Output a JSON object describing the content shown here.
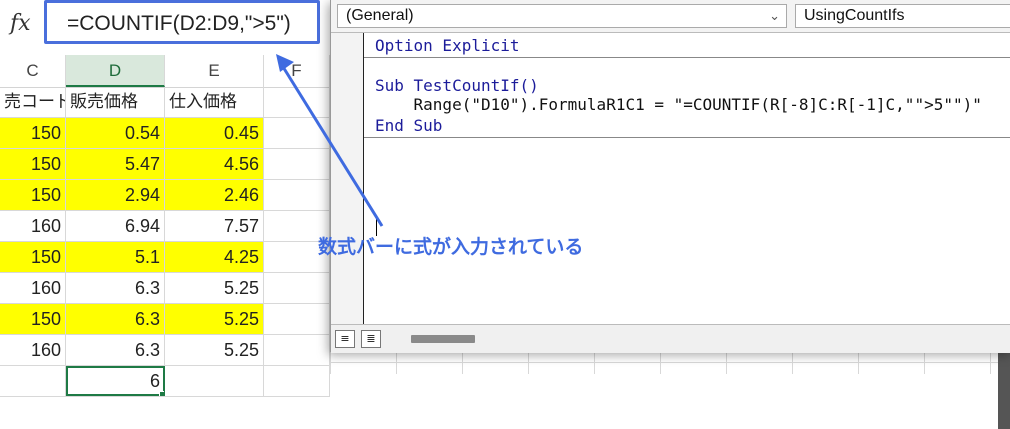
{
  "formula_bar": {
    "fx_label": "fx",
    "formula": "=COUNTIF(D2:D9,\">5\")"
  },
  "columns": [
    "C",
    "D",
    "E",
    "F"
  ],
  "selected_column": "D",
  "headers": {
    "c": "売コード",
    "d": "販売価格",
    "e": "仕入価格"
  },
  "rows": [
    {
      "c": "150",
      "d": "0.54",
      "e": "0.45",
      "highlight": true
    },
    {
      "c": "150",
      "d": "5.47",
      "e": "4.56",
      "highlight": true
    },
    {
      "c": "150",
      "d": "2.94",
      "e": "2.46",
      "highlight": true
    },
    {
      "c": "160",
      "d": "6.94",
      "e": "7.57",
      "highlight": false
    },
    {
      "c": "150",
      "d": "5.1",
      "e": "4.25",
      "highlight": true
    },
    {
      "c": "160",
      "d": "6.3",
      "e": "5.25",
      "highlight": false
    },
    {
      "c": "150",
      "d": "6.3",
      "e": "5.25",
      "highlight": true
    },
    {
      "c": "160",
      "d": "6.3",
      "e": "5.25",
      "highlight": false
    }
  ],
  "result_cell": "6",
  "vbe": {
    "object_combo": "(General)",
    "procedure_combo": "UsingCountIfs",
    "code": {
      "line1": "Option Explicit",
      "line2": "Sub TestCountIf()",
      "line3": "    Range(\"D10\").FormulaR1C1 = \"=COUNTIF(R[-8]C:R[-1]C,\"\">5\"\")\"",
      "line4": "End Sub"
    },
    "view_buttons": [
      "≡",
      "≣"
    ]
  },
  "annotation": "数式バーに式が入力されている",
  "colors": {
    "highlight": "#ffff00",
    "annotation": "#3f6be0",
    "selection": "#1e7a45",
    "code_keyword": "#1c1c9a"
  }
}
